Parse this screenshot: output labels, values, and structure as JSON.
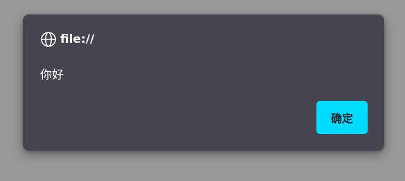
{
  "dialog": {
    "origin": "file://",
    "origin_icon": "globe-icon",
    "message": "你好",
    "ok_label": "确定"
  },
  "colors": {
    "backdrop": "#999999",
    "dialog_bg": "#46444f",
    "accent": "#00dcff",
    "text": "#ffffff",
    "button_text": "#1f1f26"
  }
}
